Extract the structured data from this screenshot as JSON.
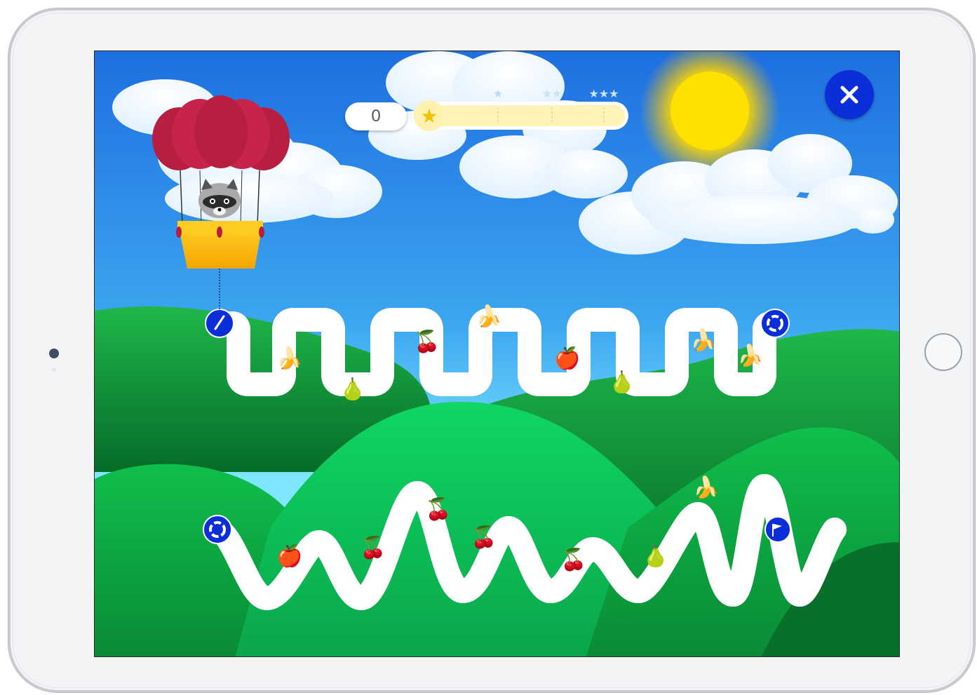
{
  "game": {
    "score": "0",
    "progress_fraction": 0.0,
    "star_thresholds": [
      "1-star",
      "2-star",
      "3-star"
    ],
    "close_icon": "close-icon",
    "start_icon": "pencil-icon",
    "restart_icon": "refresh-icon",
    "finish_icon": "flag-icon",
    "character": "raccoon-in-hot-air-balloon"
  },
  "colors": {
    "sky_top": "#1e6fe0",
    "sky_bottom": "#7fe6ff",
    "track_line": "#0d1fd6",
    "button_blue": "#0c2ed8",
    "balloon": "#b81e3f",
    "basket": "#ffc81a",
    "progress_fill": "#fff3b8",
    "hills": "#0da33d"
  },
  "fruits": {
    "row1": [
      "banana",
      "pear",
      "cherry",
      "banana",
      "apple",
      "pear",
      "banana",
      "banana"
    ],
    "row2": [
      "apple",
      "cherry",
      "cherry",
      "cherry",
      "cherry",
      "pear",
      "banana"
    ]
  },
  "fruit_glyphs": {
    "banana": "🍌",
    "pear": "🍐",
    "cherry": "🍒",
    "apple": "🍎"
  }
}
